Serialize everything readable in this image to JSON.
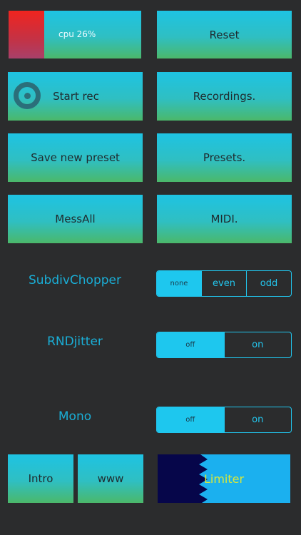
{
  "colors": {
    "background": "#2b2c2d",
    "accent": "#1ec7ee",
    "cpu_red": "#f0241f",
    "limiter_blue": "#1bb0ef",
    "limiter_dark": "#06064a",
    "limiter_text": "#d8e83a"
  },
  "cpu": {
    "label": "cpu 26%",
    "value": 26
  },
  "buttons": {
    "reset": "Reset",
    "start_rec": "Start rec",
    "recordings": "Recordings.",
    "save_new_preset": "Save new preset",
    "presets": "Presets.",
    "messall": "MessAll",
    "midi": "MIDI.",
    "intro": "Intro",
    "www": "www"
  },
  "subdiv_chopper": {
    "label": "SubdivChopper",
    "options": [
      "none",
      "even",
      "odd"
    ],
    "selected": "none"
  },
  "rnd_jitter": {
    "label": "RNDjitter",
    "options": [
      "off",
      "on"
    ],
    "selected": "off"
  },
  "mono": {
    "label": "Mono",
    "options": [
      "off",
      "on"
    ],
    "selected": "off"
  },
  "limiter": {
    "label": "Limiter"
  },
  "icons": {
    "record": "record-icon"
  }
}
